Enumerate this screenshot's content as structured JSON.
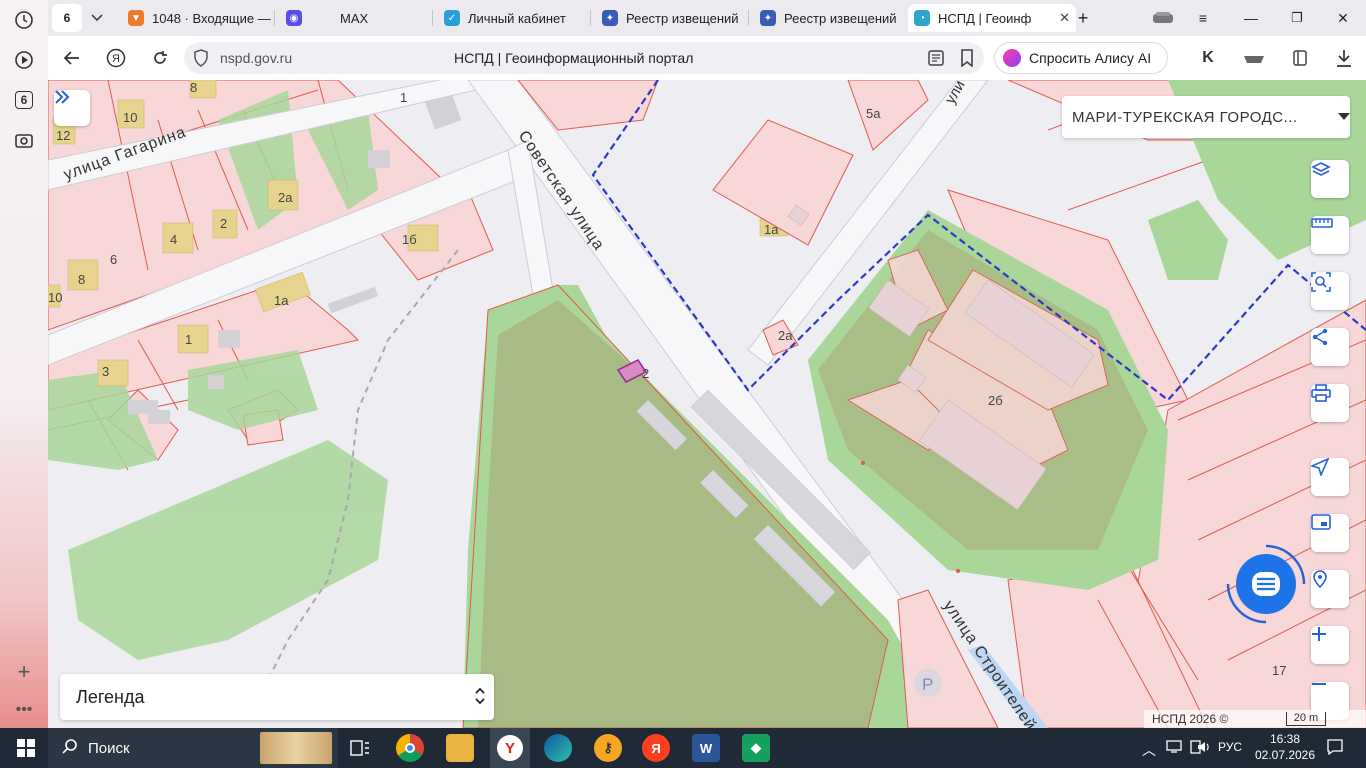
{
  "sidebar": {
    "tab_count": "6"
  },
  "tabs": {
    "group_count": "6",
    "items": [
      {
        "label": "1048 · Входящие —"
      },
      {
        "label": "MAX"
      },
      {
        "label": "Личный кабинет"
      },
      {
        "label": "Реестр извещений"
      },
      {
        "label": "Реестр извещений"
      },
      {
        "label": "НСПД | Геоинф"
      }
    ]
  },
  "address": {
    "url": "nspd.gov.ru",
    "page_title": "НСПД | Геоинформационный портал",
    "alice_label": "Спросить Алису AI"
  },
  "map": {
    "region_select": "МАРИ-ТУРЕКСКАЯ ГОРОДС...",
    "legend_label": "Легенда",
    "attribution": "НСПД 2026 ©",
    "scale_label": "20 m",
    "street_labels": {
      "gagarina": "улица Гагарина",
      "sovetskaya": "Советская улица",
      "stroitelei": "улица Строителей",
      "top": "ули"
    },
    "parcel_labels": [
      "12",
      "10",
      "8",
      "1",
      "2а",
      "4",
      "2",
      "6",
      "8",
      "10",
      "1б",
      "1а",
      "1",
      "3",
      "5а",
      "1а",
      "2а",
      "2",
      "2б",
      "17"
    ],
    "parking": "P",
    "colors": {
      "parcel_fill": "#f7d7d7",
      "parcel_stroke": "#e05a4e",
      "green": "#a9d79a",
      "forest": "#a8bb84",
      "boundary": "#2b39c9",
      "building": "#e6d48e"
    }
  },
  "taskbar": {
    "search_label": "Поиск",
    "lang": "РУС",
    "time": "16:38",
    "date": "02.07.2026"
  }
}
